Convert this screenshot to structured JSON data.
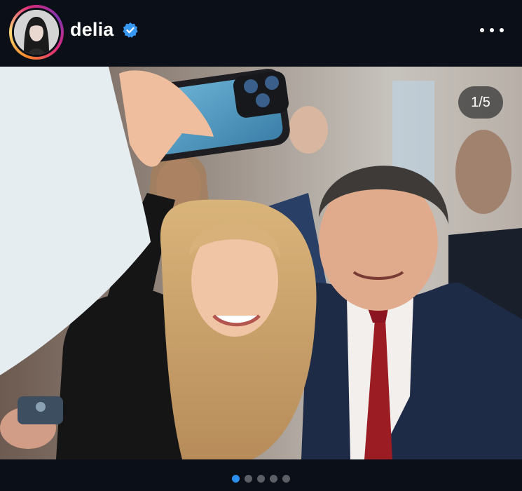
{
  "post": {
    "username": "delia",
    "verified": true,
    "verified_icon": "verified-badge-icon",
    "more_icon": "more-options-icon",
    "counter": "1/5",
    "slide_count": 5,
    "active_slide": 1
  },
  "colors": {
    "background": "#0b0f17",
    "accent": "#2b8ff0",
    "dot_inactive": "#5d5f66",
    "verified": "#3897f0"
  }
}
